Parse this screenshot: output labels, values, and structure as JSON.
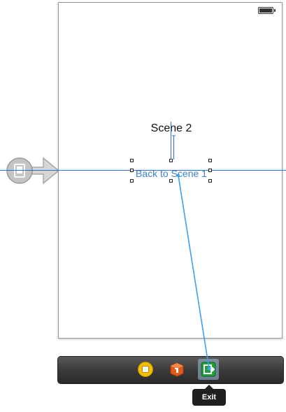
{
  "scene": {
    "title_label": "Scene 2",
    "button_label": "Back to Scene 1"
  },
  "dock": {
    "items": [
      {
        "icon": "view-controller-icon",
        "label": ""
      },
      {
        "icon": "first-responder-icon",
        "label": ""
      },
      {
        "icon": "exit-icon",
        "label": "Exit"
      }
    ],
    "tooltip": "Exit"
  },
  "colors": {
    "button_text": "#3d7fc9",
    "guide_line": "#2f6fd0",
    "connection_line": "#3aa0f0",
    "dock_background": "#3a3a3a"
  }
}
